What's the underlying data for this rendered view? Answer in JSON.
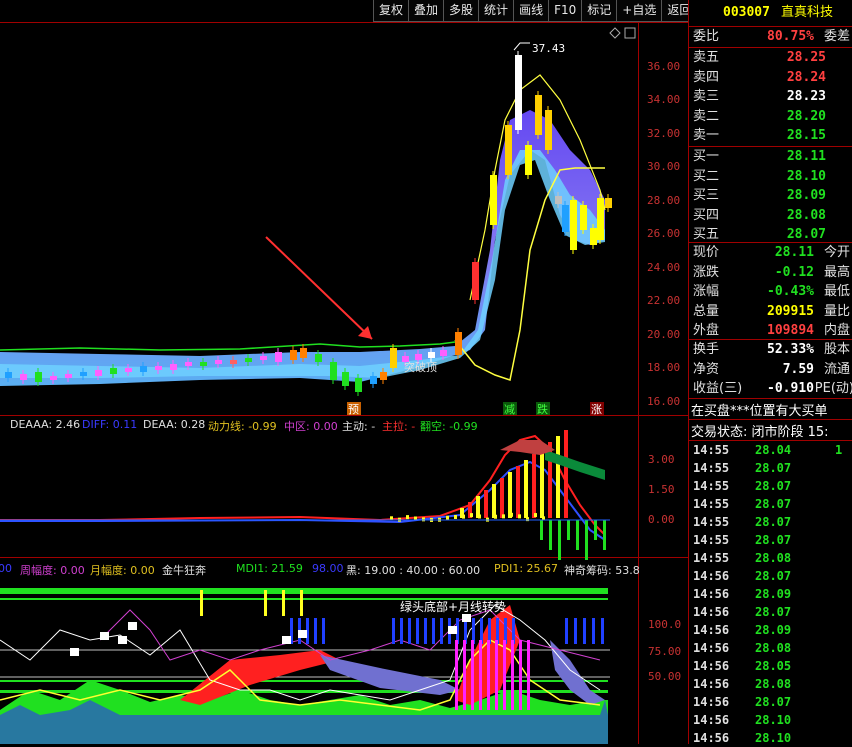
{
  "toolbar": {
    "buttons": [
      "复权",
      "叠加",
      "多股",
      "统计",
      "画线",
      "F10",
      "标记",
      "+自选",
      "返回"
    ]
  },
  "main_chart": {
    "price_axis": [
      "36.00",
      "34.00",
      "32.00",
      "30.00",
      "28.00",
      "26.00",
      "24.00",
      "22.00",
      "20.00",
      "18.00",
      "16.00"
    ],
    "high_marker": "37.43",
    "annotation": "突破顶",
    "markers": [
      "预",
      "减",
      "跌",
      "涨"
    ]
  },
  "indicator1": {
    "legend": [
      {
        "text": "DEAAA: 2.46",
        "color": "#e0e0e0"
      },
      {
        "text": "DIFF: 0.11",
        "color": "#3a3aff"
      },
      {
        "text": "DEAA: 0.28",
        "color": "#e0e0e0"
      },
      {
        "text": "动力线: -0.99",
        "color": "#e0c020"
      },
      {
        "text": "中区: 0.00",
        "color": "#d040d0"
      },
      {
        "text": "主动: -",
        "color": "#e0e0e0"
      },
      {
        "text": "主拉: -",
        "color": "#ff3030"
      },
      {
        "text": "翻空: -0.99",
        "color": "#20e020"
      }
    ],
    "axis": [
      "3.00",
      "1.50",
      "0.00"
    ]
  },
  "indicator2": {
    "legend": [
      {
        "text": "00",
        "color": "#3a3aff"
      },
      {
        "text": "周幅度: 0.00",
        "color": "#d040d0"
      },
      {
        "text": "月幅度: 0.00",
        "color": "#e0c020"
      },
      {
        "text": "金牛狂奔",
        "color": "#e0e0e0"
      },
      {
        "text": "MDI1: 21.59",
        "color": "#20e020"
      },
      {
        "text": "98.00",
        "color": "#3a3aff"
      },
      {
        "text": "黑: 19.00 : 40.00 : 60.00",
        "color": "#e0e0e0"
      },
      {
        "text": "PDI1: 25.67",
        "color": "#e0c020"
      },
      {
        "text": "神奇筹码: 53.8",
        "color": "#e0e0e0"
      }
    ],
    "annotation": "绿头底部+月线转势",
    "axis": [
      "100.0",
      "75.00",
      "50.00"
    ]
  },
  "quote": {
    "code": "003007",
    "name": "直真科技",
    "weibi_label": "委比",
    "weibi_value": "80.75%",
    "weicha_label": "委差",
    "asks": [
      {
        "label": "卖五",
        "price": "28.25",
        "color": "#ff4040"
      },
      {
        "label": "卖四",
        "price": "28.24",
        "color": "#ff4040"
      },
      {
        "label": "卖三",
        "price": "28.23",
        "color": "#ffffff"
      },
      {
        "label": "卖二",
        "price": "28.20",
        "color": "#20e020"
      },
      {
        "label": "卖一",
        "price": "28.15",
        "color": "#20e020"
      }
    ],
    "bids": [
      {
        "label": "买一",
        "price": "28.11",
        "color": "#20e020"
      },
      {
        "label": "买二",
        "price": "28.10",
        "color": "#20e020"
      },
      {
        "label": "买三",
        "price": "28.09",
        "color": "#20e020"
      },
      {
        "label": "买四",
        "price": "28.08",
        "color": "#20e020"
      },
      {
        "label": "买五",
        "price": "28.07",
        "color": "#20e020"
      }
    ],
    "stats1": [
      {
        "label": "现价",
        "value": "28.11",
        "color": "#20e020",
        "label2": "今开"
      },
      {
        "label": "涨跌",
        "value": "-0.12",
        "color": "#20e020",
        "label2": "最高"
      },
      {
        "label": "涨幅",
        "value": "-0.43%",
        "color": "#20e020",
        "label2": "最低"
      },
      {
        "label": "总量",
        "value": "209915",
        "color": "#ffff00",
        "label2": "量比"
      },
      {
        "label": "外盘",
        "value": "109894",
        "color": "#ff4040",
        "label2": "内盘"
      }
    ],
    "stats2": [
      {
        "label": "换手",
        "value": "52.33%",
        "color": "#ffffff",
        "label2": "股本"
      },
      {
        "label": "净资",
        "value": "7.59",
        "color": "#ffffff",
        "label2": "流通"
      },
      {
        "label": "收益(三)",
        "value": "-0.910",
        "color": "#ffffff",
        "label2": "PE(动)"
      }
    ],
    "notice": "在买盘***位置有大买单",
    "status": "交易状态: 闭市阶段 15:",
    "ticks": [
      {
        "time": "14:55",
        "price": "28.04",
        "vol": "1"
      },
      {
        "time": "14:55",
        "price": "28.07",
        "vol": ""
      },
      {
        "time": "14:55",
        "price": "28.07",
        "vol": ""
      },
      {
        "time": "14:55",
        "price": "28.07",
        "vol": ""
      },
      {
        "time": "14:55",
        "price": "28.07",
        "vol": ""
      },
      {
        "time": "14:55",
        "price": "28.07",
        "vol": ""
      },
      {
        "time": "14:55",
        "price": "28.08",
        "vol": ""
      },
      {
        "time": "14:56",
        "price": "28.07",
        "vol": ""
      },
      {
        "time": "14:56",
        "price": "28.09",
        "vol": ""
      },
      {
        "time": "14:56",
        "price": "28.07",
        "vol": ""
      },
      {
        "time": "14:56",
        "price": "28.09",
        "vol": ""
      },
      {
        "time": "14:56",
        "price": "28.08",
        "vol": ""
      },
      {
        "time": "14:56",
        "price": "28.05",
        "vol": ""
      },
      {
        "time": "14:56",
        "price": "28.08",
        "vol": ""
      },
      {
        "time": "14:56",
        "price": "28.07",
        "vol": ""
      },
      {
        "time": "14:56",
        "price": "28.10",
        "vol": ""
      },
      {
        "time": "14:56",
        "price": "28.10",
        "vol": ""
      }
    ]
  }
}
